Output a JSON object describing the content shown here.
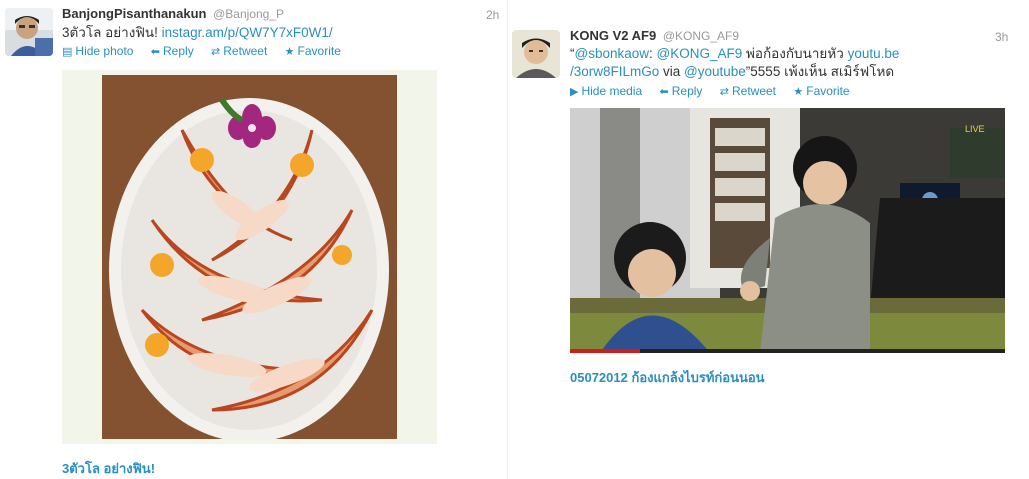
{
  "tweet1": {
    "fullname": "BanjongPisanthanakun",
    "username": "@Banjong_P",
    "time": "2h",
    "text": "3ตัวโล อย่างฟิน!",
    "link": "instagr.am/p/QW7Y7xF0W1/",
    "actions": {
      "hide": "Hide photo",
      "reply": "Reply",
      "retweet": "Retweet",
      "favorite": "Favorite"
    },
    "caption": "3ตัวโล อย่างฟิน!"
  },
  "tweet2": {
    "fullname": "KONG V2 AF9",
    "username": "@KONG_AF9",
    "time": "3h",
    "text_quote_open": "“",
    "mention1": "@sbonkaow",
    "colon": ": ",
    "mention2": "@KONG_AF9",
    "text_mid": " พ่อก้องกับนายหัว ",
    "link1": "youtu.be",
    "link2": "/3orw8FILmGo",
    "via": " via ",
    "mention3": "@youtube",
    "text_end": "”5555 เพ้งเห็น สเมิร์ฟโหด",
    "actions": {
      "hide": "Hide media",
      "reply": "Reply",
      "retweet": "Retweet",
      "favorite": "Favorite"
    },
    "video_logo": "LIVE",
    "caption": "05072012 ก้องแกล้งไบรท์ก่อนนอน"
  },
  "colors": {
    "link": "#2a8fbd",
    "name": "#333333",
    "meta": "#999999"
  }
}
